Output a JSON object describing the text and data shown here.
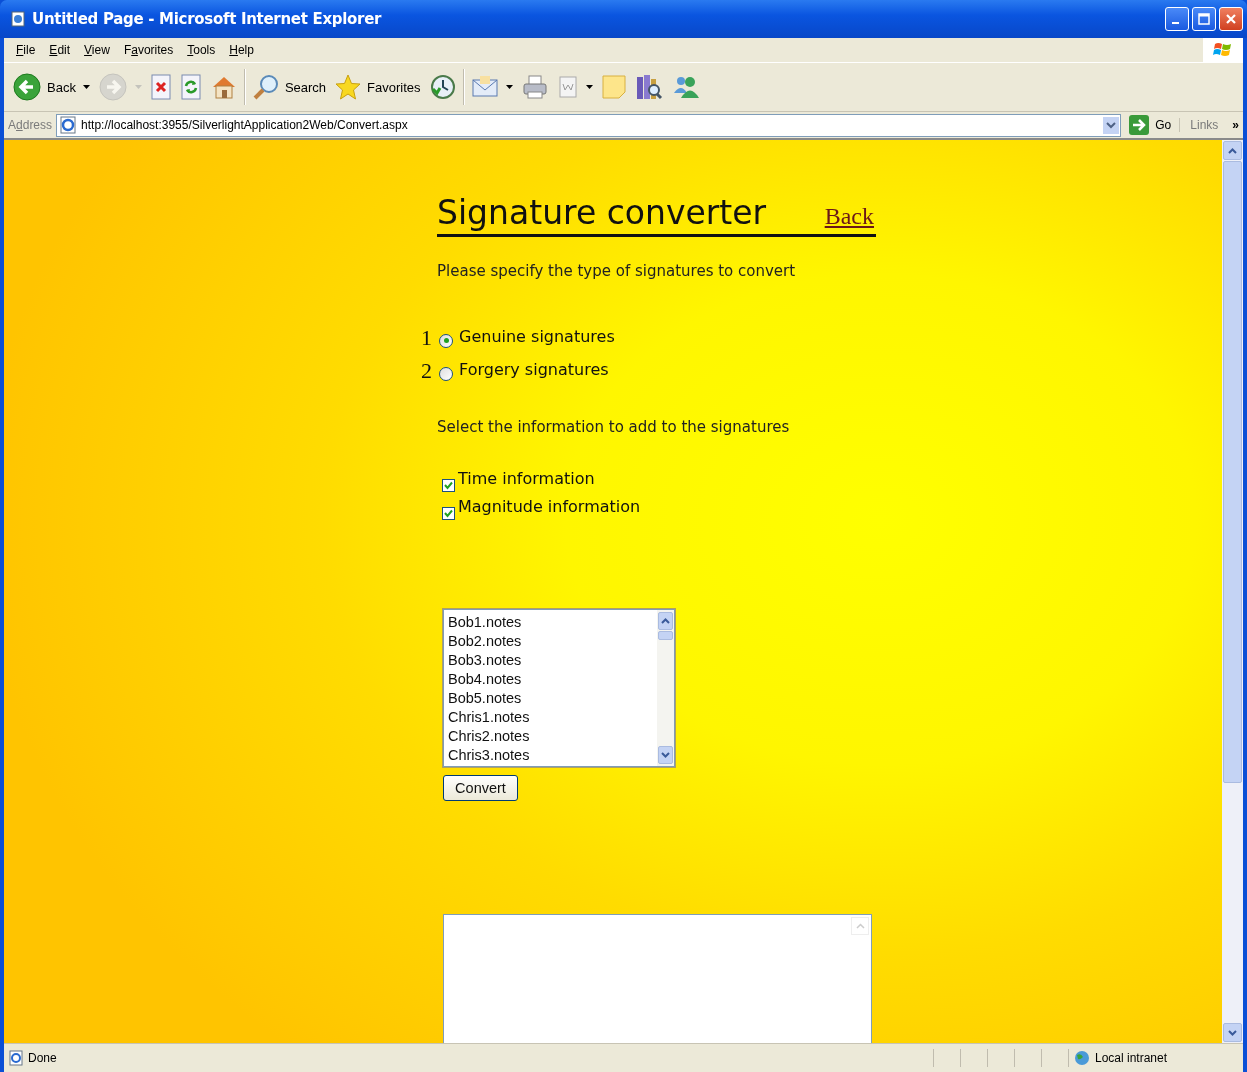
{
  "window": {
    "title": "Untitled Page - Microsoft Internet Explorer"
  },
  "menu": [
    {
      "key": "F",
      "post": "ile"
    },
    {
      "key": "E",
      "post": "dit"
    },
    {
      "key": "V",
      "post": "iew"
    },
    {
      "pre": "F",
      "key": "a",
      "post": "vorites"
    },
    {
      "key": "T",
      "post": "ools"
    },
    {
      "key": "H",
      "post": "elp"
    }
  ],
  "toolbar_groups": [
    [
      {
        "kind": "back",
        "label": "Back",
        "dropdown": true,
        "disabled": false
      },
      {
        "kind": "forward",
        "dropdown": true,
        "disabled": true
      },
      {
        "kind": "stop",
        "dropdown": false,
        "disabled": false
      },
      {
        "kind": "refresh",
        "dropdown": false,
        "disabled": false
      },
      {
        "kind": "home",
        "dropdown": false,
        "disabled": false
      }
    ],
    [
      {
        "kind": "search",
        "label": "Search",
        "dropdown": false,
        "disabled": false
      },
      {
        "kind": "favorites",
        "label": "Favorites",
        "dropdown": false,
        "disabled": false
      },
      {
        "kind": "history",
        "dropdown": false,
        "disabled": false
      }
    ],
    [
      {
        "kind": "mail",
        "dropdown": true,
        "disabled": false
      },
      {
        "kind": "print",
        "dropdown": false,
        "disabled": false
      },
      {
        "kind": "edit",
        "dropdown": true,
        "disabled": false
      },
      {
        "kind": "note",
        "dropdown": false,
        "disabled": false
      },
      {
        "kind": "research",
        "dropdown": false,
        "disabled": false
      },
      {
        "kind": "messenger",
        "dropdown": false,
        "disabled": false
      }
    ]
  ],
  "address_bar": {
    "label": {
      "pre": "A",
      "key": "d",
      "post": "dress"
    },
    "url": "http://localhost:3955/SilverlightApplication2Web/Convert.aspx",
    "go": "Go",
    "links": "Links",
    "more": "»"
  },
  "page": {
    "heading": "Signature converter",
    "back_link": "Back",
    "type_prompt": "Please specify the type of signatures to convert",
    "signature_types": [
      {
        "number": "1",
        "label": "Genuine signatures",
        "selected": true
      },
      {
        "number": "2",
        "label": "Forgery signatures",
        "selected": false
      }
    ],
    "info_prompt": "Select the information to add to the signatures",
    "info_options": [
      {
        "label": "Time information",
        "checked": true
      },
      {
        "label": "Magnitude information",
        "checked": true
      }
    ],
    "files": [
      "Bob1.notes",
      "Bob2.notes",
      "Bob3.notes",
      "Bob4.notes",
      "Bob5.notes",
      "Chris1.notes",
      "Chris2.notes",
      "Chris3.notes"
    ],
    "convert_button": "Convert"
  },
  "status_bar": {
    "text": "Done",
    "zone": "Local intranet"
  }
}
